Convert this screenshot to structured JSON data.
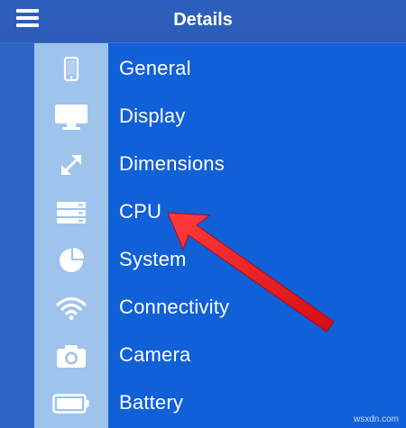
{
  "header": {
    "title": "Details"
  },
  "menu": [
    {
      "label": "General",
      "icon": "phone-icon"
    },
    {
      "label": "Display",
      "icon": "monitor-icon"
    },
    {
      "label": "Dimensions",
      "icon": "expand-arrows-icon"
    },
    {
      "label": "CPU",
      "icon": "server-stack-icon"
    },
    {
      "label": "System",
      "icon": "pie-chart-icon"
    },
    {
      "label": "Connectivity",
      "icon": "wifi-icon"
    },
    {
      "label": "Camera",
      "icon": "camera-icon"
    },
    {
      "label": "Battery",
      "icon": "battery-icon"
    }
  ],
  "annotation": {
    "arrow_color": "#e8141c",
    "points_to": "CPU"
  },
  "watermark": "wsxdn.com",
  "colors": {
    "header_bg": "#2c5fbc",
    "icon_column_bg": "#9ec3ec",
    "list_bg": "#1060d8",
    "text": "#ffffff"
  }
}
